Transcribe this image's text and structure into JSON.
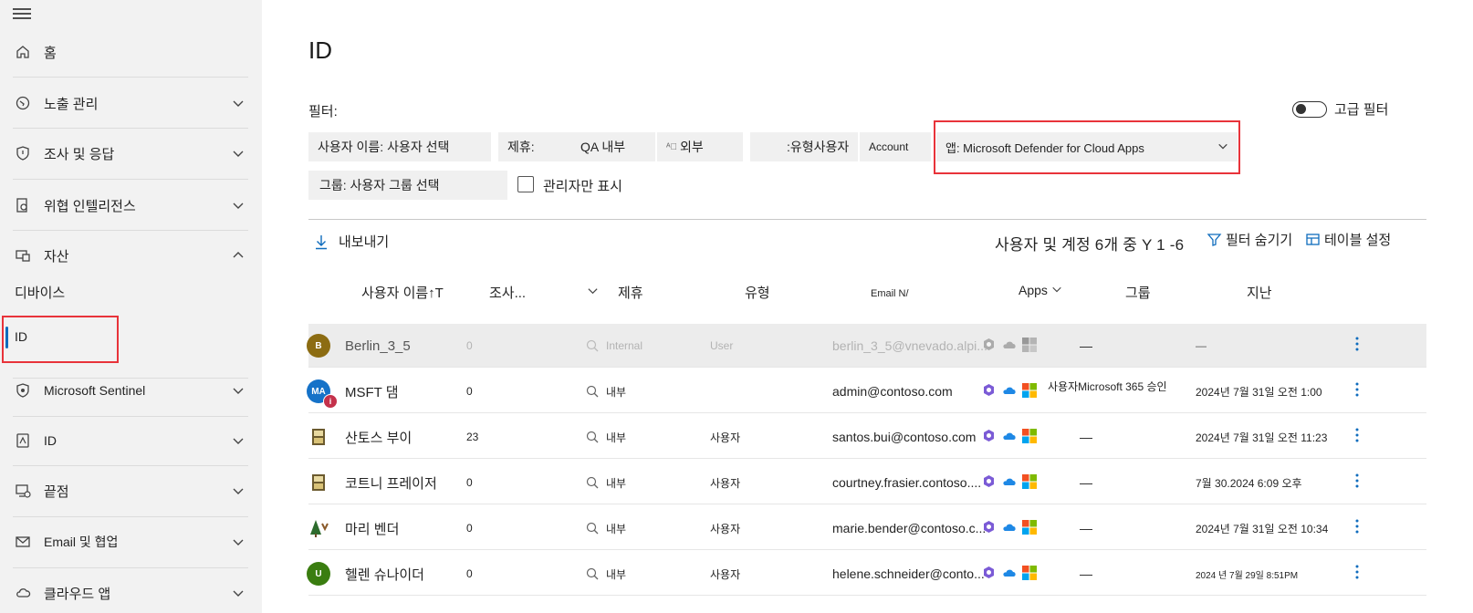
{
  "sidebar": {
    "items": [
      {
        "label": "홈",
        "icon": "home-icon"
      },
      {
        "label": "노출 관리",
        "icon": "exposure-icon"
      },
      {
        "label": "조사 및 응답",
        "icon": "shield-icon"
      },
      {
        "label": "위협 인텔리전스",
        "icon": "threat-intel-icon"
      },
      {
        "label": "자산",
        "icon": "assets-icon"
      },
      {
        "label": "Microsoft Sentinel",
        "icon": "sentinel-icon"
      },
      {
        "label": "ID",
        "icon": "id-card-icon"
      },
      {
        "label": "끝점",
        "icon": "endpoint-icon"
      },
      {
        "label": "Email 및 협업",
        "icon": "mail-icon"
      },
      {
        "label": "클라우드 앱",
        "icon": "cloud-icon"
      }
    ],
    "sub_items": {
      "devices": "디바이스",
      "identities": "ID"
    }
  },
  "page": {
    "title": "ID"
  },
  "filters": {
    "label": "필터:",
    "user_name_chip": "사용자 이름:  사용자 선택",
    "affiliation_label": "제휴:",
    "affiliation_internal": "QA 내부",
    "affiliation_external": "외부",
    "type_label": ":유형사용자",
    "type_account": "Account",
    "app_chip": "앱: Microsoft Defender for Cloud Apps",
    "group_chip": "그룹: 사용자 그룹 선택",
    "admin_only_label": "관리자만 표시",
    "advanced_filters_label": "고급 필터"
  },
  "toolbar": {
    "export_label": "내보내기",
    "count_text": "사용자 및 계정 6개 중 Y 1 -6",
    "hide_filters_label": "필터 숨기기",
    "table_settings_label": "테이블 설정"
  },
  "table": {
    "headers": {
      "user_name": "사용자 이름↑T",
      "investigation": "조사...",
      "affiliation": "제휴",
      "type": "유형",
      "email": "Email N/",
      "apps": "Apps",
      "groups": "그룹",
      "last_seen": "지난"
    },
    "rows": [
      {
        "initials": "B",
        "avatar_color": "#8c6c12",
        "name": "Berlin_3_5",
        "investigation": "0",
        "affiliation": "Internal",
        "type": "User",
        "email": "berlin_3_5@vnevado.alpi...",
        "groups": "—",
        "last_seen": "—"
      },
      {
        "initials": "MA",
        "avatar_color": "#1572c8",
        "name": "MSFT 댐",
        "investigation": "0",
        "affiliation": "내부",
        "type": "",
        "email": "admin@contoso.com",
        "groups": "사용자Microsoft 365 승인",
        "last_seen": "2024년 7월 31일 오전 1:00"
      },
      {
        "initials": "",
        "avatar_color": "",
        "name": "산토스 부이",
        "investigation": "23",
        "affiliation": "내부",
        "type": "사용자",
        "email": "santos.bui@contoso.com",
        "groups": "—",
        "last_seen": "2024년 7월 31일 오전 11:23"
      },
      {
        "initials": "",
        "avatar_color": "",
        "name": "코트니 프레이저",
        "investigation": "0",
        "affiliation": "내부",
        "type": "사용자",
        "email": "courtney.frasier.contoso....",
        "groups": "—",
        "last_seen": "7월 30.2024 6:09 오후"
      },
      {
        "initials": "",
        "avatar_color": "",
        "name": "마리 벤더",
        "investigation": "0",
        "affiliation": "내부",
        "type": "사용자",
        "email": "marie.bender@contoso.c...",
        "groups": "—",
        "last_seen": "2024년 7월 31일 오전 10:34"
      },
      {
        "initials": "U",
        "avatar_color": "#3a7d10",
        "name": "헬렌 슈나이더",
        "investigation": "0",
        "affiliation": "내부",
        "type": "사용자",
        "email": "helene.schneider@conto...",
        "groups": "—",
        "last_seen": "2024 년 7월 29일 8:51PM"
      }
    ]
  },
  "colors": {
    "accent": "#0f6cbd",
    "highlight": "#e8333a",
    "sidebar_bg": "#f2f2f2"
  }
}
